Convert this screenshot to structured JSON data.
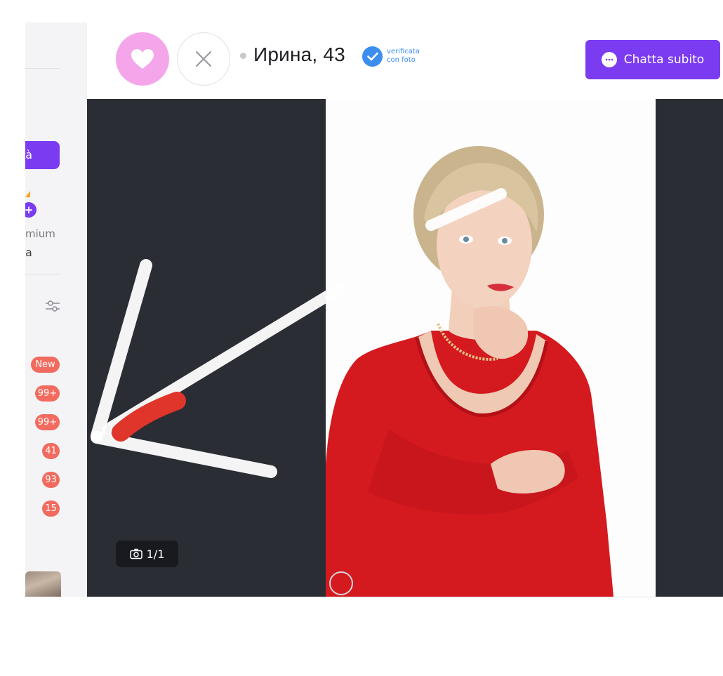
{
  "sidebar": {
    "cta_label": "tà",
    "premium_line1": "mium",
    "premium_line2": "a",
    "plus_label": "+",
    "badges": [
      "New",
      "99+",
      "99+",
      "41",
      "93",
      "15"
    ]
  },
  "profile": {
    "name_age": "Ирина, 43",
    "verified_line1": "verificata",
    "verified_line2": "con foto"
  },
  "actions": {
    "chat_label": "Chatta subito"
  },
  "photo": {
    "counter": "1/1"
  },
  "colors": {
    "accent": "#7b3bf0",
    "like": "#f5a6ea",
    "verified": "#3b8df0",
    "badge": "#f26b5e",
    "photo_bg": "#2a2d33"
  },
  "icons": [
    "heart-icon",
    "close-icon",
    "check-icon",
    "chat-bubble-icon",
    "camera-icon",
    "filter-icon"
  ]
}
